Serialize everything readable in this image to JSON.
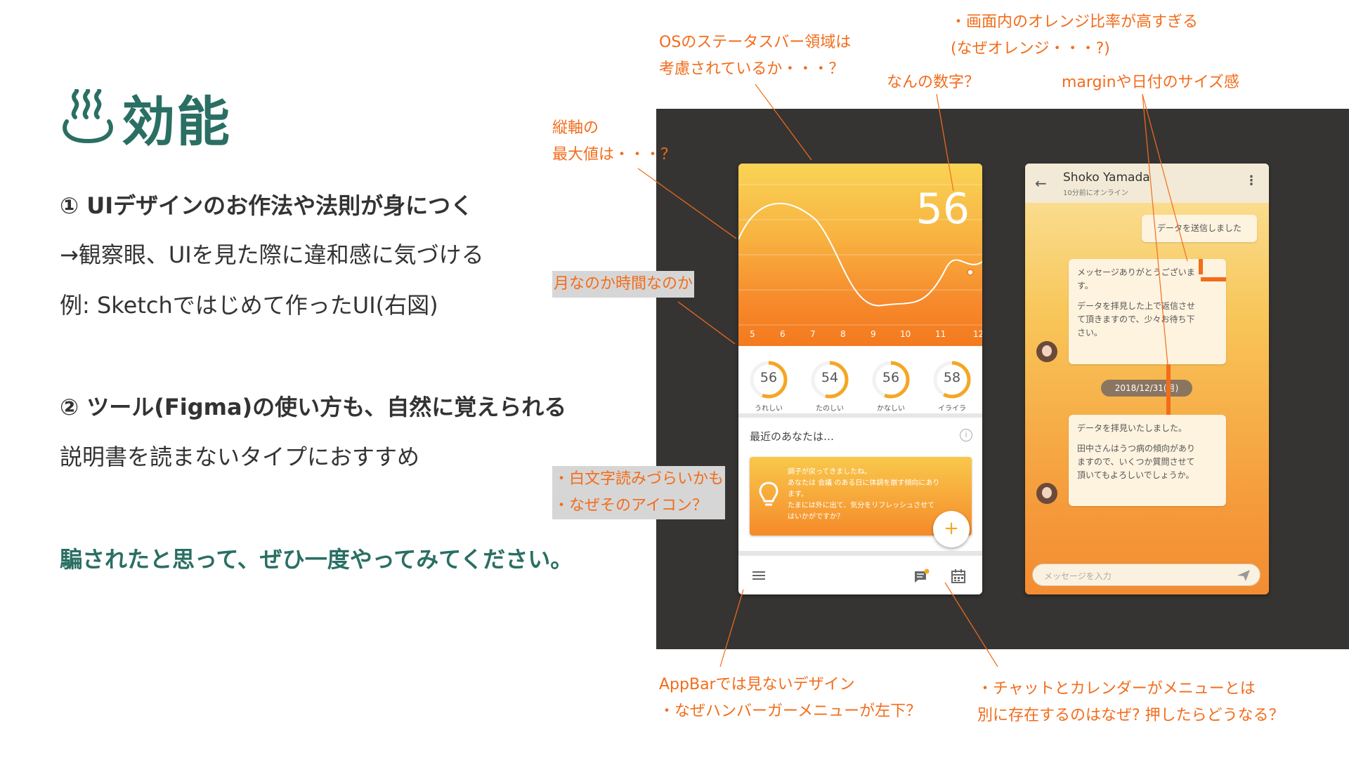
{
  "slide": {
    "title": "効能",
    "point1": "① UIデザインのお作法や法則が身につく",
    "point1_sub1": "→観察眼、UIを見た際に違和感に気づける",
    "point1_sub2": "例: Sketchではじめて作ったUI(右図)",
    "point2": "② ツール(Figma)の使い方も、自然に覚えられる",
    "point2_sub": "説明書を読まないタイプにおすすめ",
    "closing": "騙されたと思って、ぜひ一度やってみてください。"
  },
  "phone1": {
    "big_number": "56",
    "months": [
      "5",
      "6",
      "7",
      "8",
      "9",
      "10",
      "11",
      "12"
    ],
    "gauges": [
      {
        "value": "56",
        "label": "うれしい",
        "fraction": 0.56
      },
      {
        "value": "54",
        "label": "たのしい",
        "fraction": 0.54
      },
      {
        "value": "56",
        "label": "かなしい",
        "fraction": 0.56
      },
      {
        "value": "58",
        "label": "イライラ",
        "fraction": 0.58
      }
    ],
    "recent_title": "最近のあなたは…",
    "tip_lines": [
      "調子が戻ってきましたね。",
      "あなたは 会議 のある日に体調を崩す傾向にあり",
      "ます。",
      "たまには外に出て、気分をリフレッシュさせて",
      "はいかがですか？"
    ],
    "fab_label": "+"
  },
  "phone2": {
    "name": "Shoko Yamada",
    "status": "10分前にオンライン",
    "sent_message": "データを送信しました",
    "reply1_lines": [
      "メッセージありがとうございま",
      "す。",
      "",
      "データを拝見した上で返信させ",
      "て頂きますので、少々お待ち下",
      "さい。"
    ],
    "date": "2018/12/31(月)",
    "reply2_lines": [
      "データを拝見いたしました。",
      "",
      "田中さんはうつ病の傾向があり",
      "ますので、いくつか質問させて",
      "頂いてもよろしいでしょうか。"
    ],
    "input_placeholder": "メッセージを入力"
  },
  "annotations": {
    "statusbar": [
      "OSのステータスバー領域は",
      "考慮されているか・・・？"
    ],
    "orange_ratio": [
      "・画面内のオレンジ比率が高すぎる",
      "(なぜオレンジ・・・?)"
    ],
    "number": "なんの数字？",
    "margin": "marginや日付のサイズ感",
    "yaxis": [
      "縦軸の",
      "最大値は・・・？"
    ],
    "month_or_time": "月なのか時間なのか",
    "white_text": [
      "・白文字読みづらいかも",
      "・なぜそのアイコン？"
    ],
    "appbar": [
      "AppBarでは見ないデザイン",
      "・なぜハンバーガーメニューが左下？"
    ],
    "menu": [
      "・チャットとカレンダーがメニューとは",
      "別に存在するのはなぜ? 押したらどうなる？"
    ]
  },
  "colors": {
    "accent_green": "#2a6f63",
    "annotation_orange": "#f36c1b",
    "board": "#363433"
  }
}
